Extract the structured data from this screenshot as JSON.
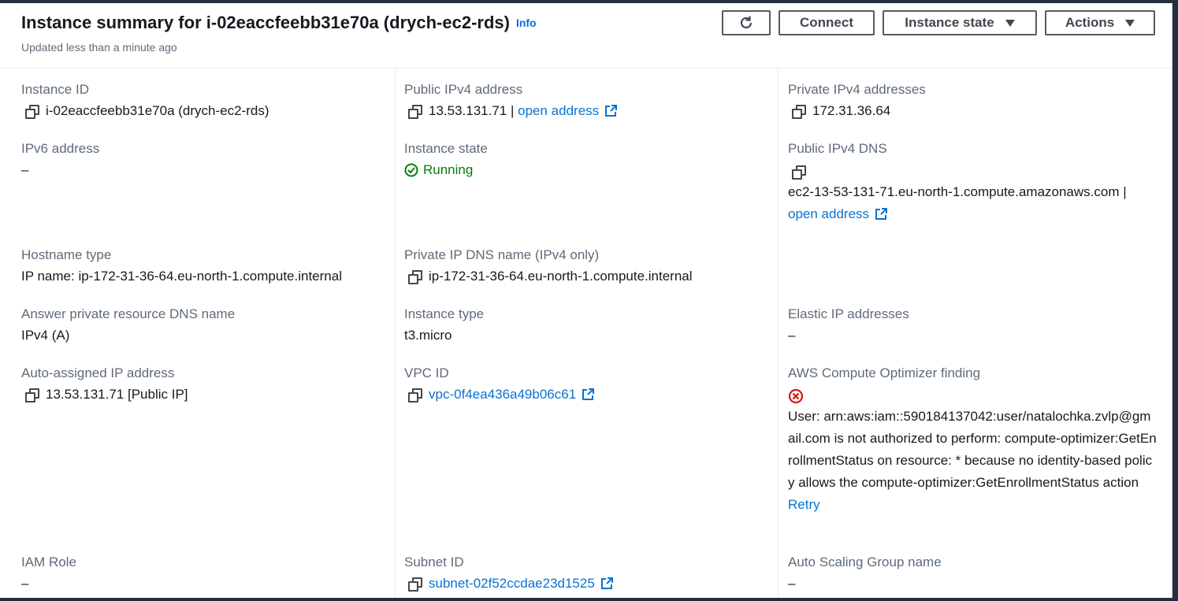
{
  "header": {
    "title": "Instance summary for i-02eaccfeebb31e70a (drych-ec2-rds)",
    "info": "Info",
    "updated": "Updated less than a minute ago",
    "connect": "Connect",
    "instance_state": "Instance state",
    "actions": "Actions",
    "refresh_icon": "refresh-icon"
  },
  "fields": {
    "instance_id": {
      "label": "Instance ID",
      "value": "i-02eaccfeebb31e70a (drych-ec2-rds)"
    },
    "public_ipv4": {
      "label": "Public IPv4 address",
      "value": "13.53.131.71 |",
      "link": "open address"
    },
    "private_ipv4": {
      "label": "Private IPv4 addresses",
      "value": "172.31.36.64"
    },
    "ipv6": {
      "label": "IPv6 address",
      "value": "–"
    },
    "instance_state": {
      "label": "Instance state",
      "value": "Running"
    },
    "public_dns": {
      "label": "Public IPv4 DNS",
      "value": "ec2-13-53-131-71.eu-north-1.compute.amazonaws.com |",
      "link": "open address"
    },
    "hostname_type": {
      "label": "Hostname type",
      "value": "IP name: ip-172-31-36-64.eu-north-1.compute.internal"
    },
    "private_dns": {
      "label": "Private IP DNS name (IPv4 only)",
      "value": "ip-172-31-36-64.eu-north-1.compute.internal"
    },
    "answer_dns": {
      "label": "Answer private resource DNS name",
      "value": "IPv4 (A)"
    },
    "instance_type": {
      "label": "Instance type",
      "value": "t3.micro"
    },
    "elastic_ip": {
      "label": "Elastic IP addresses",
      "value": "–"
    },
    "auto_ip": {
      "label": "Auto-assigned IP address",
      "value": "13.53.131.71 [Public IP]"
    },
    "vpc_id": {
      "label": "VPC ID",
      "value": "vpc-0f4ea436a49b06c61"
    },
    "optimizer": {
      "label": "AWS Compute Optimizer finding",
      "error": "User: arn:aws:iam::590184137042:user/natalochka.zvlp@gmail.com is not authorized to perform: compute-optimizer:GetEnrollmentStatus on resource: * because no identity-based policy allows the compute-optimizer:GetEnrollmentStatus action",
      "retry": "Retry"
    },
    "iam_role": {
      "label": "IAM Role",
      "value": "–"
    },
    "subnet_id": {
      "label": "Subnet ID",
      "value": "subnet-02f52ccdae23d1525"
    },
    "asg_name": {
      "label": "Auto Scaling Group name",
      "value": "–"
    }
  },
  "colors": {
    "link": "#0972d3",
    "running": "#037f0c",
    "error": "#d91515",
    "label": "#5f6b7a"
  }
}
